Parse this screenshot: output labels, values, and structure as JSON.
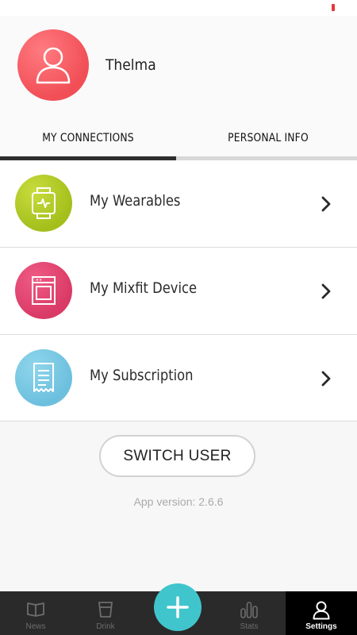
{
  "profile": {
    "name": "Thelma",
    "avatar_icon": "user-icon"
  },
  "tabs": [
    {
      "label": "MY CONNECTIONS",
      "active": true
    },
    {
      "label": "PERSONAL INFO",
      "active": false
    }
  ],
  "list": [
    {
      "label": "My Wearables",
      "icon": "watch-icon",
      "color": "#a9c31f"
    },
    {
      "label": "My Mixfit Device",
      "icon": "device-icon",
      "color": "#de3f6a"
    },
    {
      "label": "My Subscription",
      "icon": "receipt-icon",
      "color": "#73c4e0"
    }
  ],
  "switch_user_label": "SWITCH USER",
  "app_version": "App version: 2.6.6",
  "nav": {
    "items": [
      {
        "label": "News",
        "icon": "news-icon",
        "active": false
      },
      {
        "label": "Drink",
        "icon": "drink-icon",
        "active": false
      },
      {
        "label": "Stats",
        "icon": "stats-icon",
        "active": false
      },
      {
        "label": "Settings",
        "icon": "settings-user-icon",
        "active": true
      }
    ],
    "fab_icon": "plus-icon",
    "fab_color": "#40c5cd"
  }
}
